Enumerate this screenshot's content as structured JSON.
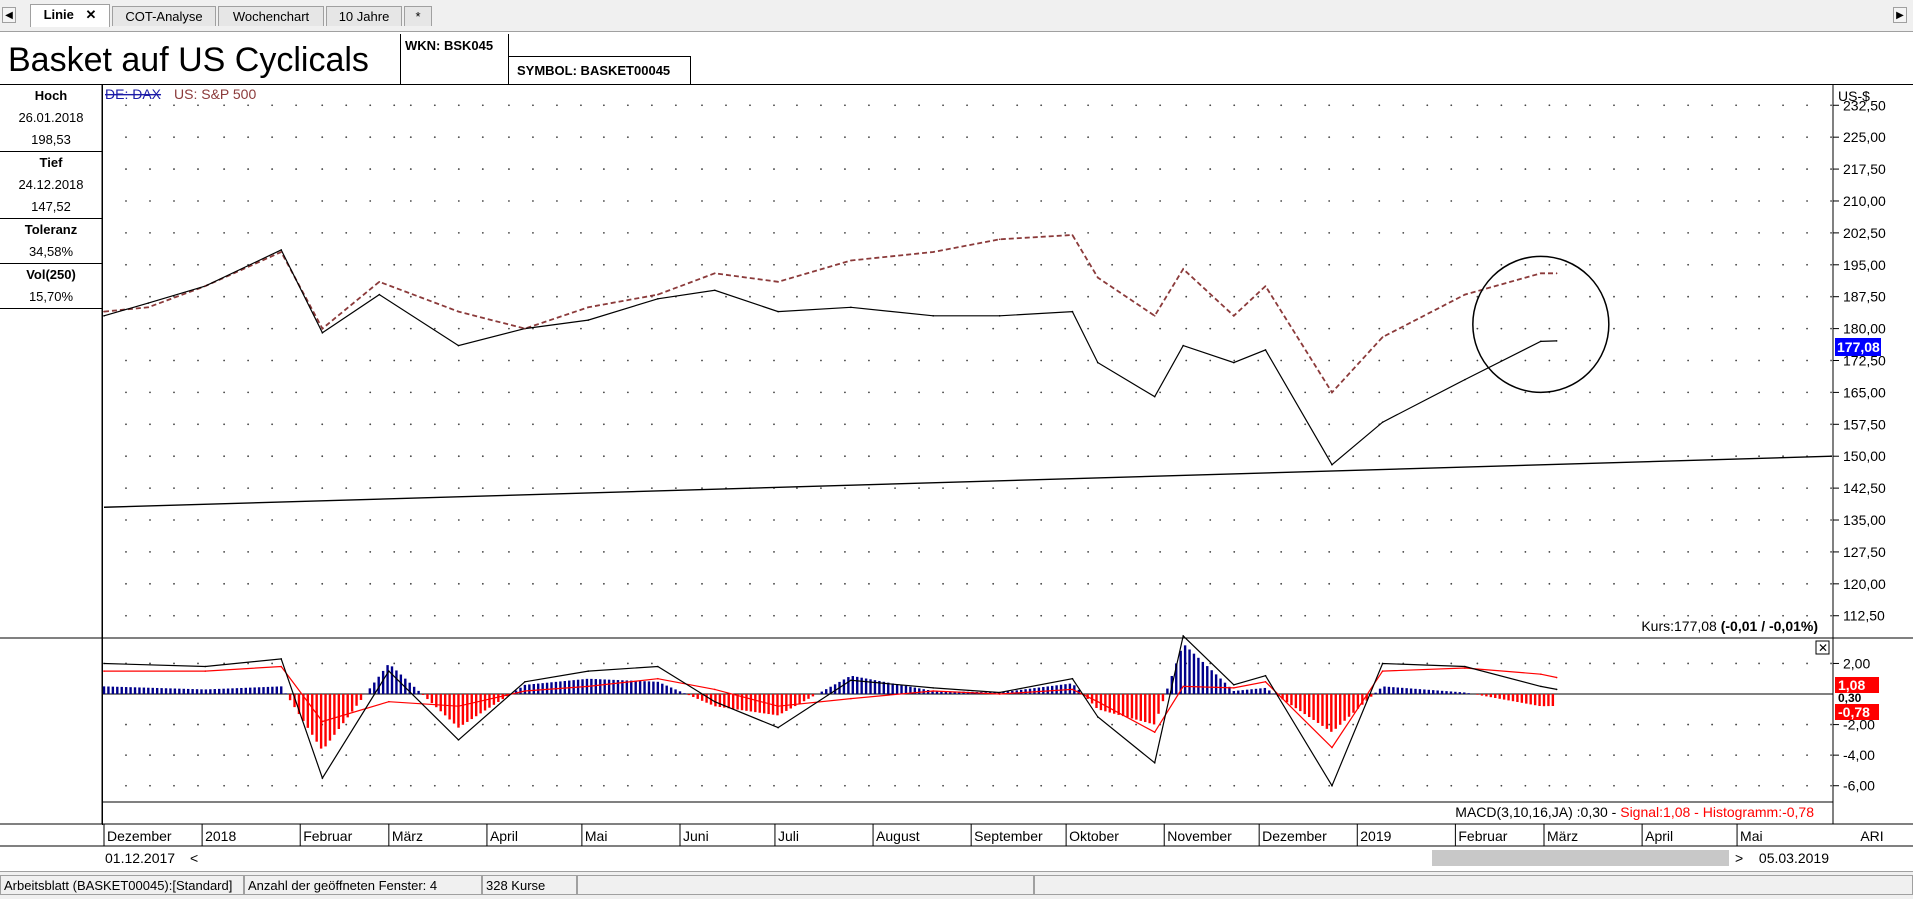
{
  "tabs": [
    {
      "label": "Linie",
      "close": "✕"
    },
    {
      "label": "COT-Analyse"
    },
    {
      "label": "Wochenchart"
    },
    {
      "label": "10 Jahre"
    },
    {
      "label": "*"
    }
  ],
  "header": {
    "title": "Basket auf US Cyclicals",
    "wkn": "WKN: BSK045",
    "symbol": "SYMBOL: BASKET00045"
  },
  "stats": [
    {
      "label": "Hoch",
      "lines": [
        "26.01.2018",
        "198,53"
      ]
    },
    {
      "label": "Tief",
      "lines": [
        "24.12.2018",
        "147,52"
      ]
    },
    {
      "label": "Toleranz",
      "lines": [
        "34,58%"
      ]
    },
    {
      "label": "Vol(250)",
      "lines": [
        "15,70%"
      ]
    }
  ],
  "legend": {
    "dax": "DE: DAX",
    "sp500": "US: S&P 500"
  },
  "price_panel": {
    "unit": "US-$",
    "current_badge": "177,08",
    "kurs_prefix": "Kurs:177,08 ",
    "kurs_change": "(-0,01 / -0,01%)"
  },
  "macd_panel": {
    "label_main": "MACD(3,10,16,JA) :0,30 - ",
    "label_signal": "Signal:1,08 - ",
    "label_hist": "Histogramm:-0,78",
    "badge_signal": "1,08",
    "badge_macd": "0,30",
    "badge_hist": "-0,78"
  },
  "time_axis": {
    "months": [
      "Dezember",
      "2018",
      "Februar",
      "März",
      "April",
      "Mai",
      "Juni",
      "Juli",
      "August",
      "September",
      "Oktober",
      "November",
      "Dezember",
      "2019",
      "Februar",
      "März",
      "April",
      "Mai"
    ],
    "right_label": "ARI",
    "start_date": "01.12.2017",
    "end_date": "05.03.2019",
    "scroll_left": "<",
    "scroll_right": ">"
  },
  "statusbar": {
    "worksheet": "Arbeitsblatt (BASKET00045):[Standard]",
    "windows": "Anzahl der geöffneten Fenster: 4",
    "count": "328 Kurse"
  },
  "colors": {
    "basket": "#000000",
    "sp500": "#8b3a3a",
    "dax": "#1c1ca8",
    "hist_pos": "#00008b",
    "hist_neg": "#ff0000",
    "signal": "#ff0000",
    "badge_price": "#0000ff"
  },
  "chart_data": [
    {
      "type": "line",
      "ylabel": "US-$",
      "ylim": [
        107.5,
        237.5
      ],
      "y_ticks": [
        112.5,
        120,
        127.5,
        135,
        142.5,
        150,
        157.5,
        165,
        172.5,
        180,
        187.5,
        195,
        202.5,
        210,
        217.5,
        225,
        232.5
      ],
      "y_tick_labels": [
        "112,50",
        "120,00",
        "127,50",
        "135,00",
        "142,50",
        "150,00",
        "157,50",
        "165,00",
        "172,50",
        "180,00",
        "187,50",
        "195,00",
        "202,50",
        "210,00",
        "217,50",
        "225,00",
        "232,50"
      ],
      "grid": true,
      "legend_position": "top-left",
      "x": [
        "2017-12-01",
        "2017-12-15",
        "2018-01-02",
        "2018-01-26",
        "2018-02-08",
        "2018-02-26",
        "2018-03-23",
        "2018-04-13",
        "2018-05-03",
        "2018-05-25",
        "2018-06-12",
        "2018-07-02",
        "2018-07-25",
        "2018-08-20",
        "2018-09-10",
        "2018-10-03",
        "2018-10-11",
        "2018-10-29",
        "2018-11-07",
        "2018-11-23",
        "2018-12-03",
        "2018-12-24",
        "2019-01-09",
        "2019-02-04",
        "2019-02-28",
        "2019-03-05"
      ],
      "series": [
        {
          "name": "Basket auf US Cyclicals",
          "values": [
            183,
            186,
            190,
            198.5,
            179,
            188,
            176,
            180,
            182,
            187,
            189,
            184,
            185,
            183,
            183,
            184,
            172,
            164,
            176,
            172,
            175,
            148,
            158,
            168,
            177,
            177.1
          ]
        },
        {
          "name": "US: S&P 500",
          "values": [
            184,
            185,
            190,
            198,
            180,
            191,
            184,
            180,
            185,
            188,
            193,
            191,
            196,
            198,
            201,
            202,
            192,
            183,
            194,
            183,
            190,
            165,
            178,
            188,
            193,
            193
          ]
        }
      ],
      "trendline": {
        "x": [
          "2017-12-01",
          "2019-05-31"
        ],
        "values": [
          138,
          150
        ]
      },
      "annotation": {
        "shape": "circle",
        "around": "2019-02-28"
      }
    },
    {
      "type": "bar",
      "title": "MACD(3,10,16,JA)",
      "ylim": [
        -7,
        3.6
      ],
      "y_ticks": [
        2,
        -2,
        -4,
        -6
      ],
      "y_tick_labels": [
        "2,00",
        "-2,00",
        "-4,00",
        "-6,00"
      ],
      "x": [
        "2017-12-01",
        "2018-01-02",
        "2018-01-26",
        "2018-02-08",
        "2018-03-01",
        "2018-03-23",
        "2018-04-13",
        "2018-05-03",
        "2018-05-25",
        "2018-06-12",
        "2018-07-02",
        "2018-07-25",
        "2018-08-20",
        "2018-09-10",
        "2018-10-03",
        "2018-10-11",
        "2018-10-29",
        "2018-11-07",
        "2018-11-23",
        "2018-12-03",
        "2018-12-24",
        "2019-01-09",
        "2019-02-04",
        "2019-02-28",
        "2019-03-05"
      ],
      "series": [
        {
          "name": "MACD",
          "values": [
            2.0,
            1.8,
            2.3,
            -5.5,
            1.5,
            -3.0,
            0.8,
            1.5,
            1.8,
            -0.5,
            -2.2,
            0.9,
            0.4,
            0.1,
            1.0,
            -1.5,
            -4.5,
            3.8,
            0.6,
            1.2,
            -6.0,
            2.0,
            1.8,
            0.5,
            0.3
          ]
        },
        {
          "name": "Signal",
          "values": [
            1.5,
            1.5,
            1.8,
            -1.8,
            -0.5,
            -0.8,
            0.2,
            0.5,
            1.0,
            0.3,
            -0.8,
            -0.3,
            0.2,
            0.0,
            0.3,
            -0.5,
            -2.5,
            0.5,
            0.4,
            0.8,
            -3.5,
            1.5,
            1.7,
            1.3,
            1.08
          ]
        },
        {
          "name": "Histogramm",
          "values": [
            0.5,
            0.3,
            0.5,
            -3.7,
            2.0,
            -2.2,
            0.6,
            1.0,
            0.8,
            -0.8,
            -1.4,
            1.2,
            0.2,
            0.1,
            0.7,
            -1.0,
            -2.0,
            3.3,
            0.2,
            0.4,
            -2.5,
            0.5,
            0.1,
            -0.8,
            -0.78
          ]
        }
      ]
    }
  ]
}
